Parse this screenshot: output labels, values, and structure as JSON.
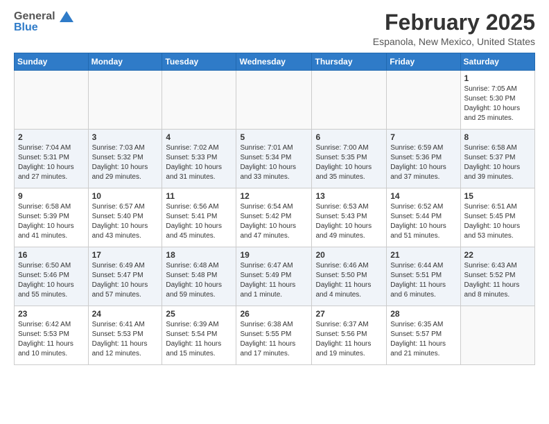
{
  "header": {
    "logo_line1": "General",
    "logo_line2": "Blue",
    "main_title": "February 2025",
    "sub_title": "Espanola, New Mexico, United States"
  },
  "weekdays": [
    "Sunday",
    "Monday",
    "Tuesday",
    "Wednesday",
    "Thursday",
    "Friday",
    "Saturday"
  ],
  "weeks": [
    [
      {
        "day": "",
        "info": ""
      },
      {
        "day": "",
        "info": ""
      },
      {
        "day": "",
        "info": ""
      },
      {
        "day": "",
        "info": ""
      },
      {
        "day": "",
        "info": ""
      },
      {
        "day": "",
        "info": ""
      },
      {
        "day": "1",
        "info": "Sunrise: 7:05 AM\nSunset: 5:30 PM\nDaylight: 10 hours and 25 minutes."
      }
    ],
    [
      {
        "day": "2",
        "info": "Sunrise: 7:04 AM\nSunset: 5:31 PM\nDaylight: 10 hours and 27 minutes."
      },
      {
        "day": "3",
        "info": "Sunrise: 7:03 AM\nSunset: 5:32 PM\nDaylight: 10 hours and 29 minutes."
      },
      {
        "day": "4",
        "info": "Sunrise: 7:02 AM\nSunset: 5:33 PM\nDaylight: 10 hours and 31 minutes."
      },
      {
        "day": "5",
        "info": "Sunrise: 7:01 AM\nSunset: 5:34 PM\nDaylight: 10 hours and 33 minutes."
      },
      {
        "day": "6",
        "info": "Sunrise: 7:00 AM\nSunset: 5:35 PM\nDaylight: 10 hours and 35 minutes."
      },
      {
        "day": "7",
        "info": "Sunrise: 6:59 AM\nSunset: 5:36 PM\nDaylight: 10 hours and 37 minutes."
      },
      {
        "day": "8",
        "info": "Sunrise: 6:58 AM\nSunset: 5:37 PM\nDaylight: 10 hours and 39 minutes."
      }
    ],
    [
      {
        "day": "9",
        "info": "Sunrise: 6:58 AM\nSunset: 5:39 PM\nDaylight: 10 hours and 41 minutes."
      },
      {
        "day": "10",
        "info": "Sunrise: 6:57 AM\nSunset: 5:40 PM\nDaylight: 10 hours and 43 minutes."
      },
      {
        "day": "11",
        "info": "Sunrise: 6:56 AM\nSunset: 5:41 PM\nDaylight: 10 hours and 45 minutes."
      },
      {
        "day": "12",
        "info": "Sunrise: 6:54 AM\nSunset: 5:42 PM\nDaylight: 10 hours and 47 minutes."
      },
      {
        "day": "13",
        "info": "Sunrise: 6:53 AM\nSunset: 5:43 PM\nDaylight: 10 hours and 49 minutes."
      },
      {
        "day": "14",
        "info": "Sunrise: 6:52 AM\nSunset: 5:44 PM\nDaylight: 10 hours and 51 minutes."
      },
      {
        "day": "15",
        "info": "Sunrise: 6:51 AM\nSunset: 5:45 PM\nDaylight: 10 hours and 53 minutes."
      }
    ],
    [
      {
        "day": "16",
        "info": "Sunrise: 6:50 AM\nSunset: 5:46 PM\nDaylight: 10 hours and 55 minutes."
      },
      {
        "day": "17",
        "info": "Sunrise: 6:49 AM\nSunset: 5:47 PM\nDaylight: 10 hours and 57 minutes."
      },
      {
        "day": "18",
        "info": "Sunrise: 6:48 AM\nSunset: 5:48 PM\nDaylight: 10 hours and 59 minutes."
      },
      {
        "day": "19",
        "info": "Sunrise: 6:47 AM\nSunset: 5:49 PM\nDaylight: 11 hours and 1 minute."
      },
      {
        "day": "20",
        "info": "Sunrise: 6:46 AM\nSunset: 5:50 PM\nDaylight: 11 hours and 4 minutes."
      },
      {
        "day": "21",
        "info": "Sunrise: 6:44 AM\nSunset: 5:51 PM\nDaylight: 11 hours and 6 minutes."
      },
      {
        "day": "22",
        "info": "Sunrise: 6:43 AM\nSunset: 5:52 PM\nDaylight: 11 hours and 8 minutes."
      }
    ],
    [
      {
        "day": "23",
        "info": "Sunrise: 6:42 AM\nSunset: 5:53 PM\nDaylight: 11 hours and 10 minutes."
      },
      {
        "day": "24",
        "info": "Sunrise: 6:41 AM\nSunset: 5:53 PM\nDaylight: 11 hours and 12 minutes."
      },
      {
        "day": "25",
        "info": "Sunrise: 6:39 AM\nSunset: 5:54 PM\nDaylight: 11 hours and 15 minutes."
      },
      {
        "day": "26",
        "info": "Sunrise: 6:38 AM\nSunset: 5:55 PM\nDaylight: 11 hours and 17 minutes."
      },
      {
        "day": "27",
        "info": "Sunrise: 6:37 AM\nSunset: 5:56 PM\nDaylight: 11 hours and 19 minutes."
      },
      {
        "day": "28",
        "info": "Sunrise: 6:35 AM\nSunset: 5:57 PM\nDaylight: 11 hours and 21 minutes."
      },
      {
        "day": "",
        "info": ""
      }
    ]
  ]
}
